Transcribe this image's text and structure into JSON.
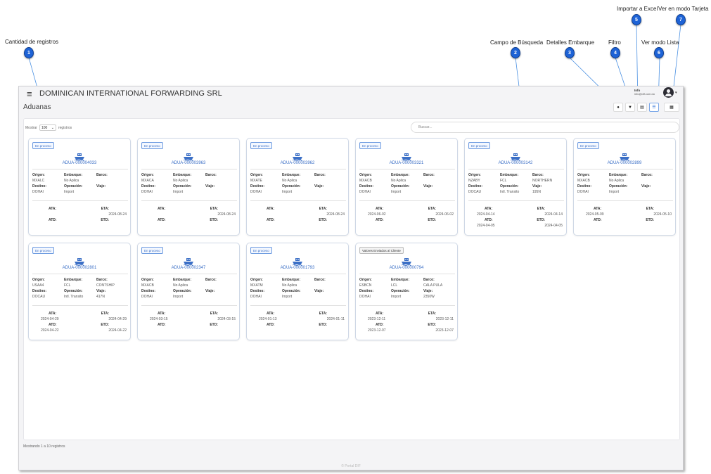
{
  "annotations": [
    {
      "num": "1",
      "label": "Cantidad de registros"
    },
    {
      "num": "2",
      "label": "Campo de Búsqueda"
    },
    {
      "num": "3",
      "label": "Detalles Embarque"
    },
    {
      "num": "4",
      "label": "Filtro"
    },
    {
      "num": "5",
      "label": "Importar a Excel"
    },
    {
      "num": "6",
      "label": "Ver modo Lista"
    },
    {
      "num": "7",
      "label": "Ver en modo Tarjeta"
    }
  ],
  "header": {
    "menu_icon": "≡",
    "company": "DOMINICAN INTERNATIONAL FORWARDING SRL",
    "user_name": "Info",
    "user_email": "info@dif.com.do",
    "avatar_icon": "user-circle-icon"
  },
  "page": {
    "title": "Aduanas"
  },
  "toolbar": {
    "details_icon": "●",
    "filter_icon": "▼",
    "excel_icon": "▤",
    "list_icon": "☰",
    "cards_icon": "▦"
  },
  "controls": {
    "show_label": "Mostrar",
    "show_value": "100",
    "show_suffix": "registros",
    "search_placeholder": "Buscar..."
  },
  "labels": {
    "origen": "Origen:",
    "embarque": "Embarque:",
    "barco": "Barco:",
    "destino": "Destino:",
    "operacion": "Operación:",
    "viaje": "Viaje:",
    "ata": "ATA:",
    "eta": "ETA:",
    "atd": "ATD:",
    "etd": "ETD:"
  },
  "cards": [
    {
      "status": "En proceso",
      "code": "ADUA-000004033",
      "origen": "MXALC",
      "embarque": "No Aplica",
      "barco": "",
      "destino": "DOHAI",
      "operacion": "Import",
      "viaje": "",
      "ata": "",
      "eta": "2024-08-24",
      "atd": "",
      "etd": ""
    },
    {
      "status": "En proceso",
      "code": "ADUA-000003963",
      "origen": "MXACA",
      "embarque": "No Aplica",
      "barco": "",
      "destino": "DOHAI",
      "operacion": "Import",
      "viaje": "",
      "ata": "",
      "eta": "2024-08-24",
      "atd": "",
      "etd": ""
    },
    {
      "status": "En proceso",
      "code": "ADUA-000003962",
      "origen": "MXATE",
      "embarque": "No Aplica",
      "barco": "",
      "destino": "DOHAI",
      "operacion": "Import",
      "viaje": "",
      "ata": "",
      "eta": "2024-08-24",
      "atd": "",
      "etd": ""
    },
    {
      "status": "En proceso",
      "code": "ADUA-000003321",
      "origen": "MXACB",
      "embarque": "No Aplica",
      "barco": "",
      "destino": "DOHAI",
      "operacion": "Import",
      "viaje": "",
      "ata": "2024-06-02",
      "eta": "2024-06-02",
      "atd": "",
      "etd": ""
    },
    {
      "status": "En proceso",
      "code": "ADUA-000003142",
      "origen": "NZABY",
      "embarque": "FCL",
      "barco": "NORTHERN",
      "destino": "DOCAU",
      "operacion": "Intl. Transito",
      "viaje": "195N",
      "ata": "2024-04-14",
      "eta": "2024-04-14",
      "atd": "2024-04-05",
      "etd": "2024-04-05"
    },
    {
      "status": "En proceso",
      "code": "ADUA-000002899",
      "origen": "MXACB",
      "embarque": "No Aplica",
      "barco": "",
      "destino": "DOHAI",
      "operacion": "Import",
      "viaje": "",
      "ata": "2024-05-09",
      "eta": "2024-05-10",
      "atd": "",
      "etd": ""
    },
    {
      "status": "En proceso",
      "code": "ADUA-000002801",
      "origen": "USAA4",
      "embarque": "FCL",
      "barco": "CONTSHIP",
      "destino": "DOCAU",
      "operacion": "Intl. Transito",
      "viaje": "417N",
      "ata": "2024-04-29",
      "eta": "2024-04-29",
      "atd": "2024-04-22",
      "etd": "2024-04-22"
    },
    {
      "status": "En proceso",
      "code": "ADUA-000002347",
      "origen": "MXACB",
      "embarque": "No Aplica",
      "barco": "",
      "destino": "DOHAI",
      "operacion": "Import",
      "viaje": "",
      "ata": "2024-03-15",
      "eta": "2024-03-15",
      "atd": "",
      "etd": ""
    },
    {
      "status": "En proceso",
      "code": "ADUA-000001793",
      "origen": "MXATM",
      "embarque": "No Aplica",
      "barco": "",
      "destino": "DOHAI",
      "operacion": "Import",
      "viaje": "",
      "ata": "2024-01-13",
      "eta": "2024-01-11",
      "atd": "",
      "etd": ""
    },
    {
      "status": "Valores Enviados al Cliente",
      "code": "ADUA-000000794",
      "origen": "ESBCN",
      "embarque": "LCL",
      "barco": "CALA PULA",
      "destino": "DOHAI",
      "operacion": "Import",
      "viaje": "2350W",
      "ata": "2023-12-11",
      "eta": "2023-12-11",
      "atd": "2023-12-07",
      "etd": "2023-12-07"
    }
  ],
  "footer": {
    "records_text": "Mostrando 1 a 10 registros",
    "copyright": "© Portal DIF"
  },
  "colors": {
    "accent": "#3b6fc6",
    "badge_blue": "#1e63d6"
  }
}
